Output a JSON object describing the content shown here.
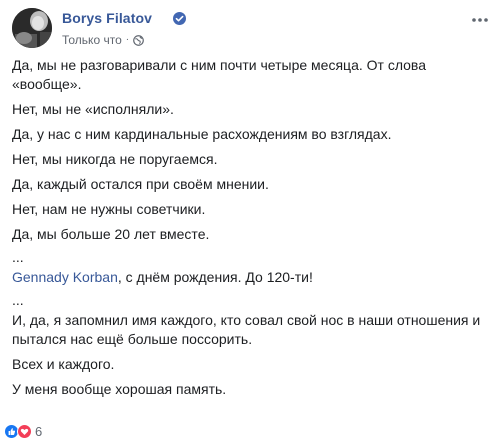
{
  "post": {
    "author": "Borys Filatov",
    "time": "Только что",
    "separator": "·",
    "paragraphs": [
      "Да, мы не разговаривали с ним почти четыре месяца. От слова «вообще».",
      "Нет, мы не «исполняли».",
      "Да, у нас с ним кардинальные расхождениям во взглядах.",
      "Нет, мы никогда не поругаемся.",
      "Да, каждый остался при своём мнении.",
      "Нет, нам не нужны советчики.",
      "Да, мы больше 20 лет вместе."
    ],
    "ellipsis_1": "...",
    "mention": "Gennady Korban",
    "birthday_text": ", с днём рождения. До 120-ти!",
    "ellipsis_2": "...",
    "closing": [
      "И, да, я запомнил имя каждого, кто совал свой нос в наши отношения и пытался нас ещё больше поссорить.",
      "Всех и каждого.",
      "У меня вообще хорошая память."
    ],
    "reactions": {
      "icons": [
        "like-icon",
        "love-icon"
      ],
      "count": "6"
    }
  },
  "colors": {
    "link": "#385898",
    "text": "#1c1e21",
    "meta": "#616770",
    "like": "#1877f2",
    "love": "#f33e58",
    "verified": "#4267b2"
  }
}
